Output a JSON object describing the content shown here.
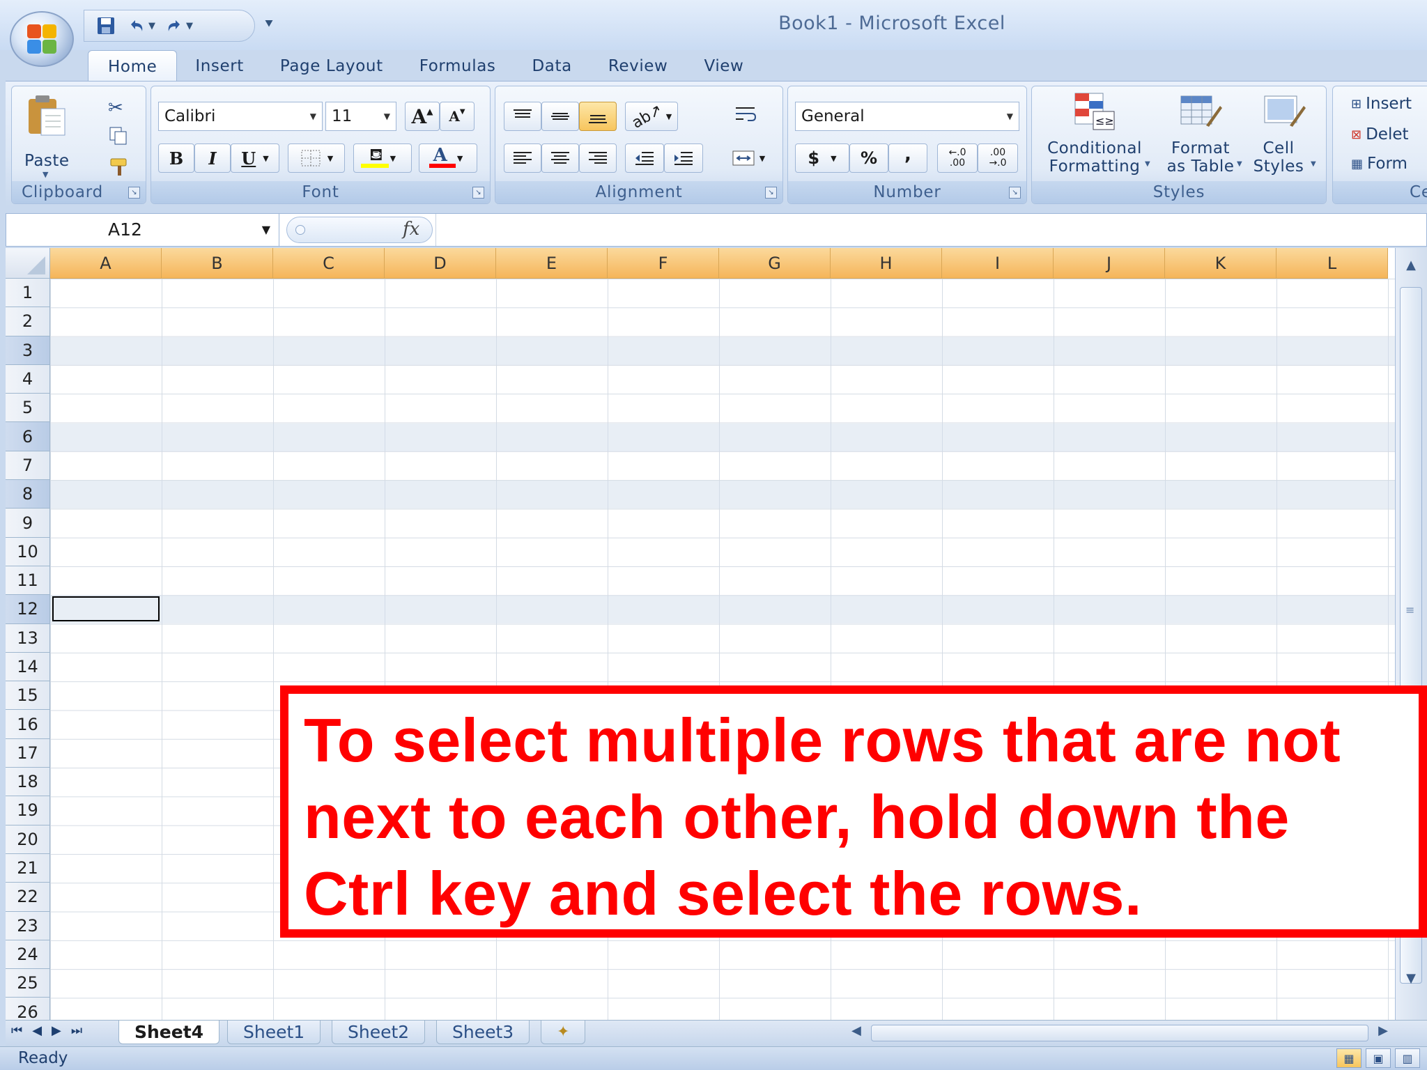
{
  "window": {
    "title": "Book1 - Microsoft Excel"
  },
  "quick_access": {
    "save_icon": "floppy-disk-icon",
    "undo_icon": "undo-icon",
    "redo_icon": "redo-icon",
    "customize_icon": "customize-arrow-icon"
  },
  "ribbon_tabs": [
    {
      "label": "Home",
      "active": true
    },
    {
      "label": "Insert"
    },
    {
      "label": "Page Layout"
    },
    {
      "label": "Formulas"
    },
    {
      "label": "Data"
    },
    {
      "label": "Review"
    },
    {
      "label": "View"
    }
  ],
  "groups": {
    "clipboard": {
      "label": "Clipboard",
      "paste_label": "Paste"
    },
    "font": {
      "label": "Font",
      "font_name": "Calibri",
      "font_size": "11",
      "bold": "B",
      "italic": "I",
      "underline": "U",
      "grow": "A",
      "shrink": "A",
      "font_color_letter": "A",
      "fill_color": "#ffff00",
      "font_color": "#ff0000"
    },
    "alignment": {
      "label": "Alignment"
    },
    "number": {
      "label": "Number",
      "format": "General",
      "currency": "$",
      "percent": "%",
      "comma": ",",
      "inc_decimal": "←.0\n.00",
      "dec_decimal": ".00\n→.0"
    },
    "styles": {
      "label": "Styles",
      "conditional_formatting": "Conditional\nFormatting",
      "format_as_table": "Format\nas Table",
      "cell_styles": "Cell\nStyles"
    },
    "cells": {
      "label": "Cells",
      "insert": "Insert",
      "delete": "Delet",
      "format": "Form"
    }
  },
  "formula_bar": {
    "name_box": "A12",
    "fx_label": "fx",
    "formula": ""
  },
  "grid": {
    "columns": [
      "A",
      "B",
      "C",
      "D",
      "E",
      "F",
      "G",
      "H",
      "I",
      "J",
      "K",
      "L"
    ],
    "rows": [
      "1",
      "2",
      "3",
      "4",
      "5",
      "6",
      "7",
      "8",
      "9",
      "10",
      "11",
      "12",
      "13",
      "14",
      "15",
      "16",
      "17",
      "18",
      "19",
      "20",
      "21",
      "22",
      "23",
      "24",
      "25",
      "26"
    ],
    "highlighted_rows": [
      "3",
      "6",
      "8",
      "12"
    ],
    "active_cell": "A12"
  },
  "sheets": [
    {
      "label": "Sheet4",
      "active": true
    },
    {
      "label": "Sheet1"
    },
    {
      "label": "Sheet2"
    },
    {
      "label": "Sheet3"
    }
  ],
  "status": {
    "text": "Ready"
  },
  "instruction": {
    "text": "To select multiple rows that are not\nnext to each other, hold down the\nCtrl key and select the rows."
  },
  "colors": {
    "header_orange": "#f5b55a",
    "instruction_red": "#ff0000",
    "ribbon_blue": "#dbe6f5"
  }
}
